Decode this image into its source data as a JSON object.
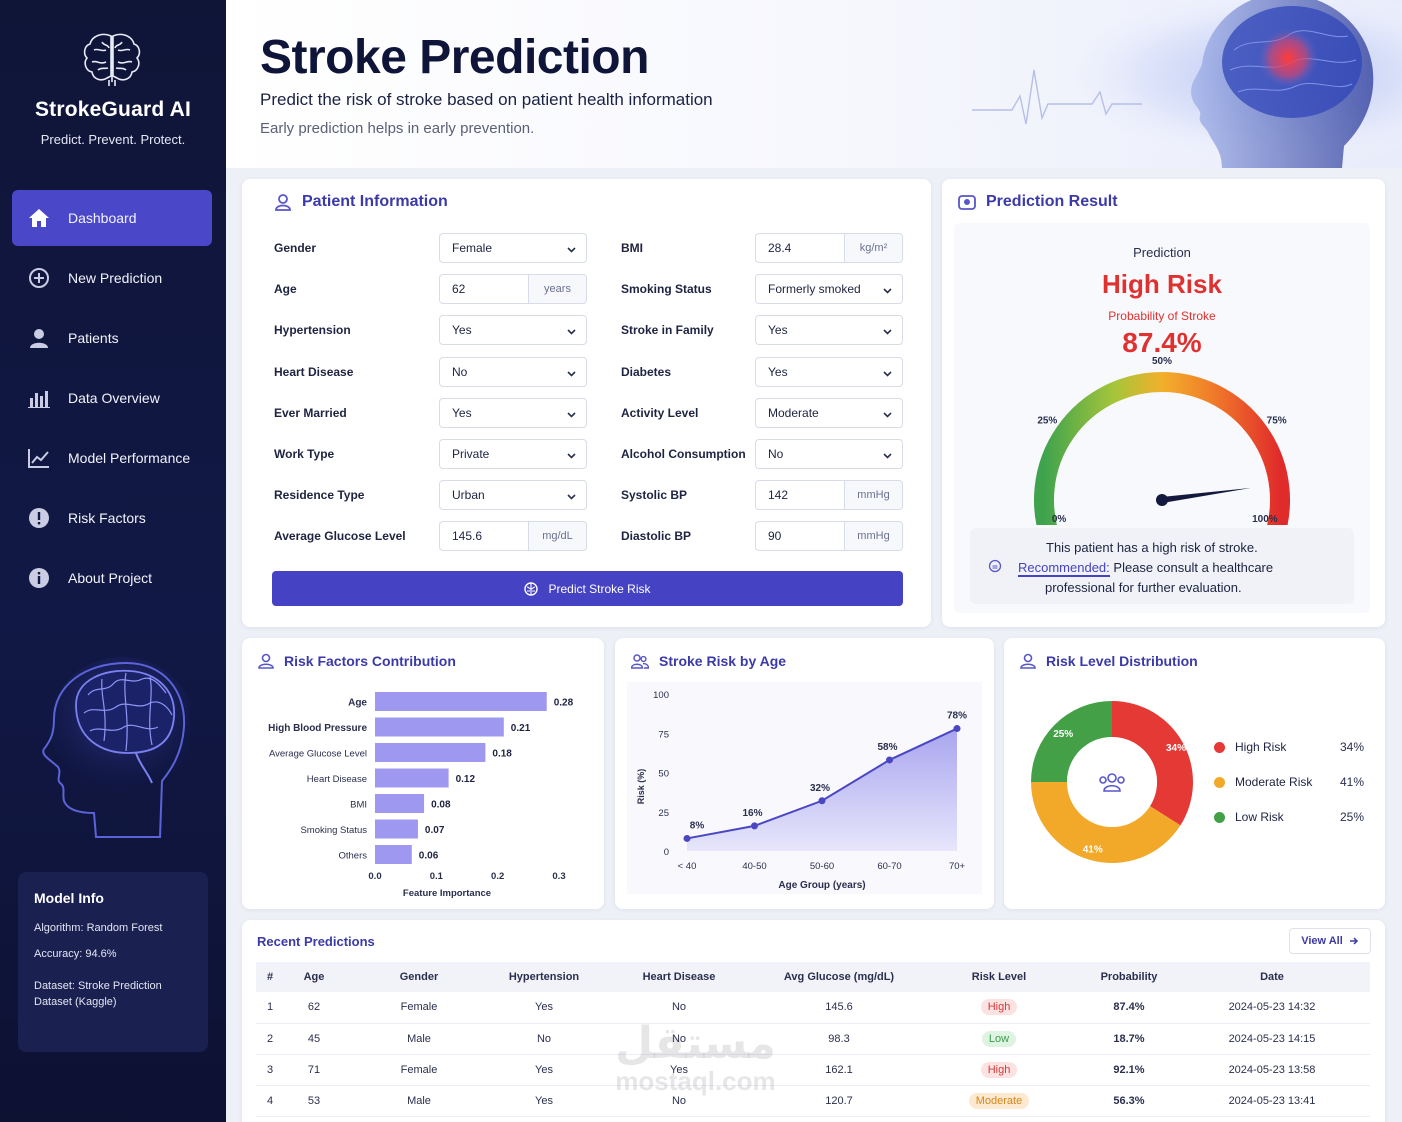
{
  "sidebar": {
    "brand_name": "StrokeGuard AI",
    "brand_tagline": "Predict. Prevent. Protect.",
    "nav": [
      {
        "label": "Dashboard",
        "icon": "home-icon",
        "active": true
      },
      {
        "label": "New Prediction",
        "icon": "plus-circle-icon"
      },
      {
        "label": "Patients",
        "icon": "user-icon"
      },
      {
        "label": "Data Overview",
        "icon": "bar-chart-icon"
      },
      {
        "label": "Model Performance",
        "icon": "line-chart-icon"
      },
      {
        "label": "Risk Factors",
        "icon": "alert-circle-icon"
      },
      {
        "label": "About Project",
        "icon": "info-icon"
      }
    ],
    "model_info": {
      "title": "Model Info",
      "algorithm_label": "Algorithm:",
      "algorithm": "Random Forest",
      "accuracy_label": "Accuracy:",
      "accuracy": "94.6%",
      "dataset_label": "Dataset:",
      "dataset": "Stroke Prediction Dataset (Kaggle)"
    }
  },
  "header": {
    "title": "Stroke Prediction",
    "subtitle": "Predict the risk of stroke based on patient health information",
    "note": "Early prediction helps in early prevention."
  },
  "patient_form": {
    "title": "Patient Information",
    "left": [
      {
        "label": "Gender",
        "value": "Female",
        "type": "select"
      },
      {
        "label": "Age",
        "value": "62",
        "unit": "years",
        "type": "input"
      },
      {
        "label": "Hypertension",
        "value": "Yes",
        "type": "select"
      },
      {
        "label": "Heart Disease",
        "value": "No",
        "type": "select"
      },
      {
        "label": "Ever Married",
        "value": "Yes",
        "type": "select"
      },
      {
        "label": "Work Type",
        "value": "Private",
        "type": "select"
      },
      {
        "label": "Residence Type",
        "value": "Urban",
        "type": "select"
      },
      {
        "label": "Average Glucose Level",
        "value": "145.6",
        "unit": "mg/dL",
        "type": "input"
      }
    ],
    "right": [
      {
        "label": "BMI",
        "value": "28.4",
        "unit": "kg/m²",
        "type": "input"
      },
      {
        "label": "Smoking Status",
        "value": "Formerly smoked",
        "type": "select"
      },
      {
        "label": "Stroke in Family",
        "value": "Yes",
        "type": "select"
      },
      {
        "label": "Diabetes",
        "value": "Yes",
        "type": "select"
      },
      {
        "label": "Activity Level",
        "value": "Moderate",
        "type": "select"
      },
      {
        "label": "Alcohol Consumption",
        "value": "No",
        "type": "select"
      },
      {
        "label": "Systolic BP",
        "value": "142",
        "unit": "mmHg",
        "type": "input"
      },
      {
        "label": "Diastolic BP",
        "value": "90",
        "unit": "mmHg",
        "type": "input"
      }
    ],
    "button_label": "Predict Stroke Risk"
  },
  "result": {
    "title": "Prediction Result",
    "prediction_label": "Prediction",
    "prediction": "High Risk",
    "prob_label": "Probability of Stroke",
    "probability": "87.4%",
    "gauge_value": 87.4,
    "gauge_ticks": {
      "t0": "0%",
      "t25": "25%",
      "t50": "50%",
      "t75": "75%",
      "t100": "100%"
    },
    "message": "This patient has a high risk of stroke.",
    "rec_label": "Recommended:",
    "rec_text_1": "Please consult a healthcare",
    "rec_text_2": "professional for further evaluation."
  },
  "risk_factors": {
    "title": "Risk Factors Contribution",
    "xlabel": "Feature Importance",
    "ticks": [
      "0.0",
      "0.1",
      "0.2",
      "0.3"
    ]
  },
  "age_risk": {
    "title": "Stroke Risk by Age",
    "xlabel": "Age Group (years)",
    "ylabel": "Risk (%)",
    "yticks": [
      "0",
      "25",
      "50",
      "75",
      "100"
    ]
  },
  "distribution": {
    "title": "Risk Level Distribution",
    "items": [
      {
        "name": "High Risk",
        "value": "34%",
        "color": "#e53935"
      },
      {
        "name": "Moderate Risk",
        "value": "41%",
        "color": "#f2a92a"
      },
      {
        "name": "Low Risk",
        "value": "25%",
        "color": "#43a047"
      }
    ]
  },
  "chart_data": [
    {
      "type": "bar",
      "orientation": "horizontal",
      "title": "Risk Factors Contribution",
      "xlabel": "Feature Importance",
      "categories": [
        "Age",
        "High Blood Pressure",
        "Average Glucose Level",
        "Heart Disease",
        "BMI",
        "Smoking Status",
        "Others"
      ],
      "values": [
        0.28,
        0.21,
        0.18,
        0.12,
        0.08,
        0.07,
        0.06
      ],
      "labels": [
        "0.28",
        "0.21",
        "0.18",
        "0.12",
        "0.08",
        "0.07",
        "0.06"
      ],
      "xlim": [
        0,
        0.3
      ]
    },
    {
      "type": "line",
      "title": "Stroke Risk by Age",
      "xlabel": "Age Group (years)",
      "ylabel": "Risk (%)",
      "categories": [
        "< 40",
        "40-50",
        "50-60",
        "60-70",
        "70+"
      ],
      "values": [
        8,
        16,
        32,
        58,
        78
      ],
      "labels": [
        "8%",
        "16%",
        "32%",
        "58%",
        "78%"
      ],
      "ylim": [
        0,
        100
      ]
    },
    {
      "type": "pie",
      "title": "Risk Level Distribution",
      "categories": [
        "High Risk",
        "Moderate Risk",
        "Low Risk"
      ],
      "values": [
        34,
        41,
        25
      ],
      "labels": [
        "34%",
        "41%",
        "25%"
      ],
      "colors": [
        "#e53935",
        "#f2a92a",
        "#43a047"
      ]
    }
  ],
  "recent": {
    "title": "Recent Predictions",
    "view_all": "View All",
    "columns": [
      "#",
      "Age",
      "Gender",
      "Hypertension",
      "Heart Disease",
      "Avg Glucose (mg/dL)",
      "Risk Level",
      "Probability",
      "Date"
    ],
    "rows": [
      [
        "1",
        "62",
        "Female",
        "Yes",
        "No",
        "145.6",
        "High",
        "87.4%",
        "2024-05-23 14:32"
      ],
      [
        "2",
        "45",
        "Male",
        "No",
        "No",
        "98.3",
        "Low",
        "18.7%",
        "2024-05-23 14:15"
      ],
      [
        "3",
        "71",
        "Female",
        "Yes",
        "Yes",
        "162.1",
        "High",
        "92.1%",
        "2024-05-23 13:58"
      ],
      [
        "4",
        "53",
        "Male",
        "Yes",
        "No",
        "120.7",
        "Moderate",
        "56.3%",
        "2024-05-23 13:41"
      ]
    ]
  },
  "watermark": {
    "arabic": "مستقل",
    "latin": "mostaql.com"
  }
}
